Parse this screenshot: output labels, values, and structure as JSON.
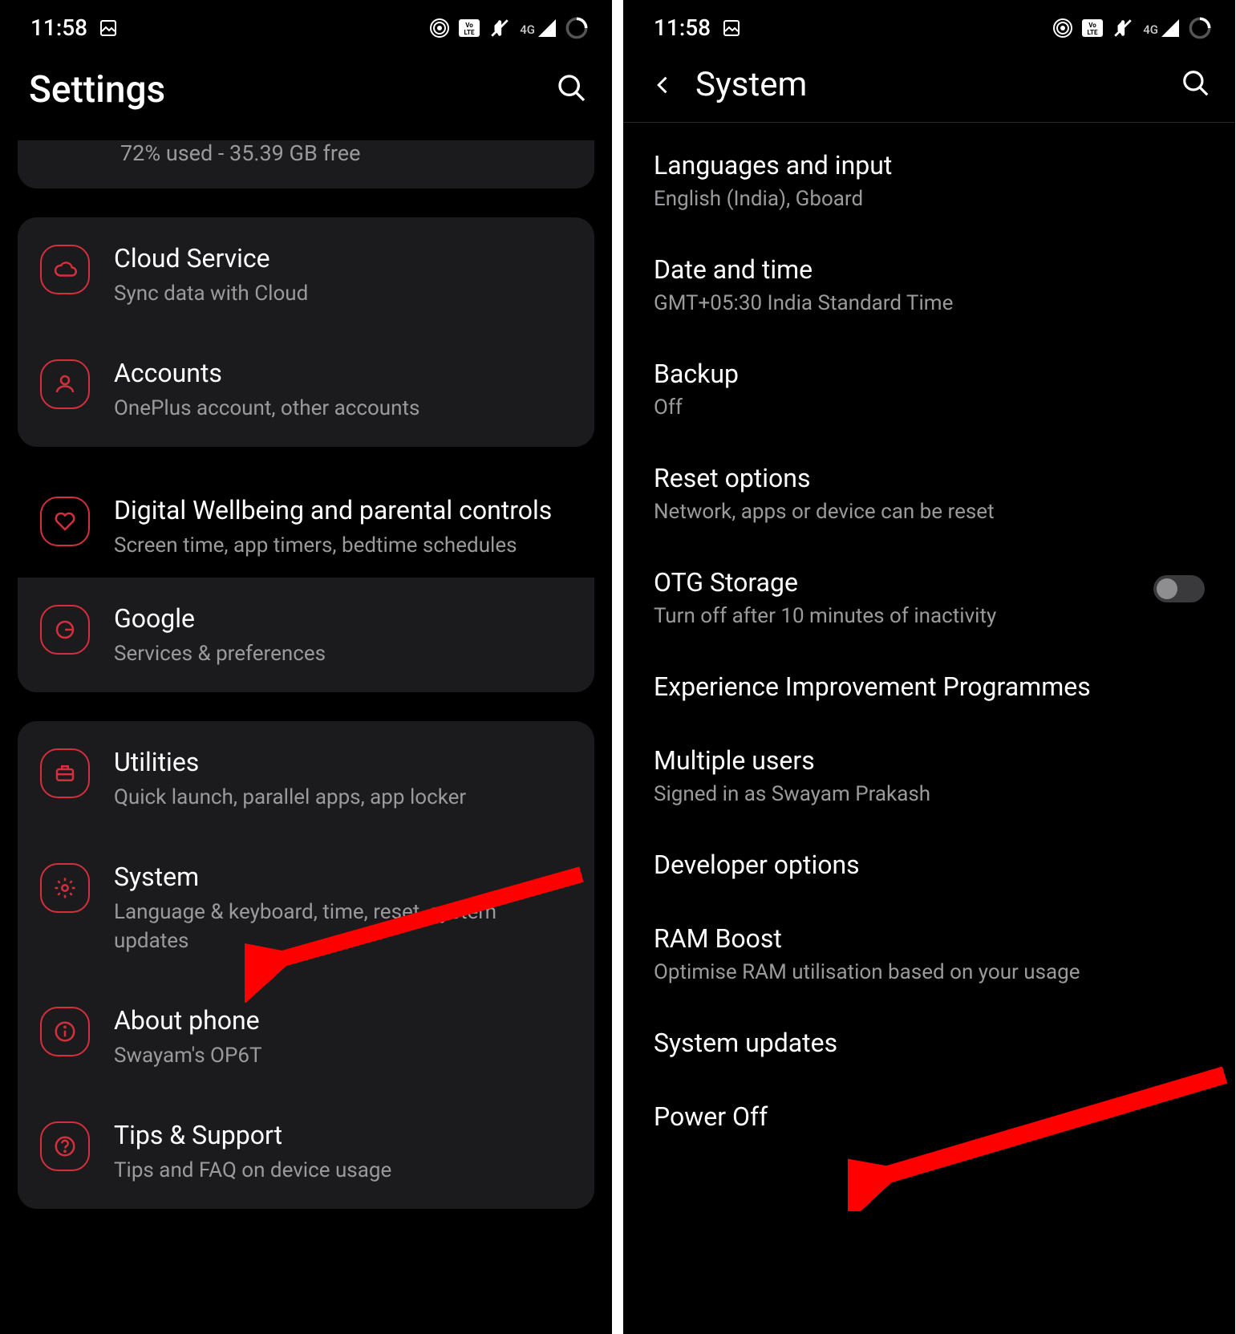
{
  "statusbar": {
    "time": "11:58",
    "net_label": "4G"
  },
  "left": {
    "title": "Settings",
    "storage_sub": "72% used - 35.39 GB free",
    "cloud": {
      "title": "Cloud Service",
      "sub": "Sync data with Cloud"
    },
    "accounts": {
      "title": "Accounts",
      "sub": "OnePlus account, other accounts"
    },
    "wellbeing": {
      "title": "Digital Wellbeing and parental controls",
      "sub": "Screen time, app timers, bedtime schedules"
    },
    "google": {
      "title": "Google",
      "sub": "Services & preferences"
    },
    "utilities": {
      "title": "Utilities",
      "sub": "Quick launch, parallel apps, app locker"
    },
    "system": {
      "title": "System",
      "sub": "Language & keyboard, time, reset, system updates"
    },
    "about": {
      "title": "About phone",
      "sub": "Swayam's OP6T"
    },
    "tips": {
      "title": "Tips & Support",
      "sub": "Tips and FAQ on device usage"
    }
  },
  "right": {
    "title": "System",
    "lang": {
      "title": "Languages and input",
      "sub": "English (India), Gboard"
    },
    "date": {
      "title": "Date and time",
      "sub": "GMT+05:30 India Standard Time"
    },
    "backup": {
      "title": "Backup",
      "sub": "Off"
    },
    "reset": {
      "title": "Reset options",
      "sub": "Network, apps or device can be reset"
    },
    "otg": {
      "title": "OTG Storage",
      "sub": "Turn off after 10 minutes of inactivity"
    },
    "exp": {
      "title": "Experience Improvement Programmes"
    },
    "multi": {
      "title": "Multiple users",
      "sub": "Signed in as Swayam Prakash"
    },
    "dev": {
      "title": "Developer options"
    },
    "ram": {
      "title": "RAM Boost",
      "sub": "Optimise RAM utilisation based on your usage"
    },
    "updates": {
      "title": "System updates"
    },
    "power": {
      "title": "Power Off"
    }
  }
}
